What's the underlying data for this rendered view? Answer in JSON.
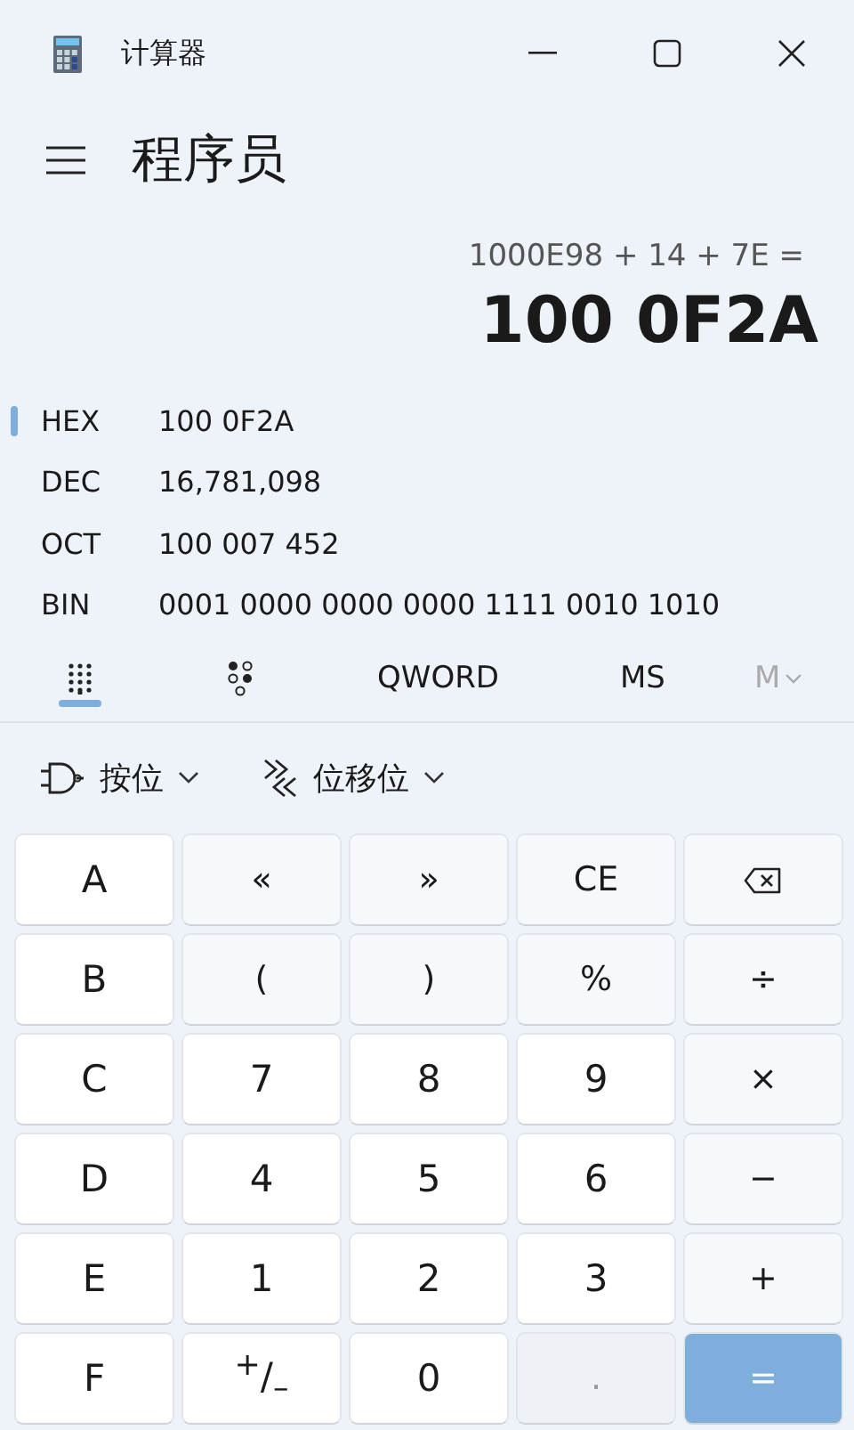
{
  "window": {
    "title": "计算器"
  },
  "header": {
    "mode": "程序员"
  },
  "display": {
    "expression": "1000E98 + 14 + 7E =",
    "result": "100 0F2A"
  },
  "radix": [
    {
      "label": "HEX",
      "value": "100 0F2A",
      "selected": true
    },
    {
      "label": "DEC",
      "value": "16,781,098",
      "selected": false
    },
    {
      "label": "OCT",
      "value": "100 007 452",
      "selected": false
    },
    {
      "label": "BIN",
      "value": "0001 0000 0000 0000 1111 0010 1010",
      "selected": false
    }
  ],
  "toolbar": {
    "tabs": [
      {
        "kind": "keypad",
        "selected": true
      },
      {
        "kind": "bits",
        "selected": false
      }
    ],
    "word_size": "QWORD",
    "memory_store": "MS",
    "memory_menu": {
      "label": "M",
      "disabled": true
    }
  },
  "dropdowns": [
    {
      "kind": "gate",
      "label": "按位"
    },
    {
      "kind": "shift",
      "label": "位移位"
    }
  ],
  "keys": [
    {
      "label": "A",
      "kind": "digit"
    },
    {
      "label": "«",
      "kind": "op"
    },
    {
      "label": "»",
      "kind": "op"
    },
    {
      "label": "CE",
      "kind": "op"
    },
    {
      "kind": "backspace"
    },
    {
      "label": "B",
      "kind": "digit"
    },
    {
      "label": "(",
      "kind": "op"
    },
    {
      "label": ")",
      "kind": "op"
    },
    {
      "label": "%",
      "kind": "op"
    },
    {
      "label": "÷",
      "kind": "op"
    },
    {
      "label": "C",
      "kind": "digit"
    },
    {
      "label": "7",
      "kind": "digit"
    },
    {
      "label": "8",
      "kind": "digit"
    },
    {
      "label": "9",
      "kind": "digit"
    },
    {
      "label": "×",
      "kind": "op"
    },
    {
      "label": "D",
      "kind": "digit"
    },
    {
      "label": "4",
      "kind": "digit"
    },
    {
      "label": "5",
      "kind": "digit"
    },
    {
      "label": "6",
      "kind": "digit"
    },
    {
      "label": "−",
      "kind": "op"
    },
    {
      "label": "E",
      "kind": "digit"
    },
    {
      "label": "1",
      "kind": "digit"
    },
    {
      "label": "2",
      "kind": "digit"
    },
    {
      "label": "3",
      "kind": "digit"
    },
    {
      "label": "+",
      "kind": "op"
    },
    {
      "label": "F",
      "kind": "digit"
    },
    {
      "label": "$^{+}$/$_{–}$",
      "kind": "digit"
    },
    {
      "label": "0",
      "kind": "digit"
    },
    {
      "label": ".",
      "kind": "disabled"
    },
    {
      "label": "=",
      "kind": "accent"
    }
  ]
}
